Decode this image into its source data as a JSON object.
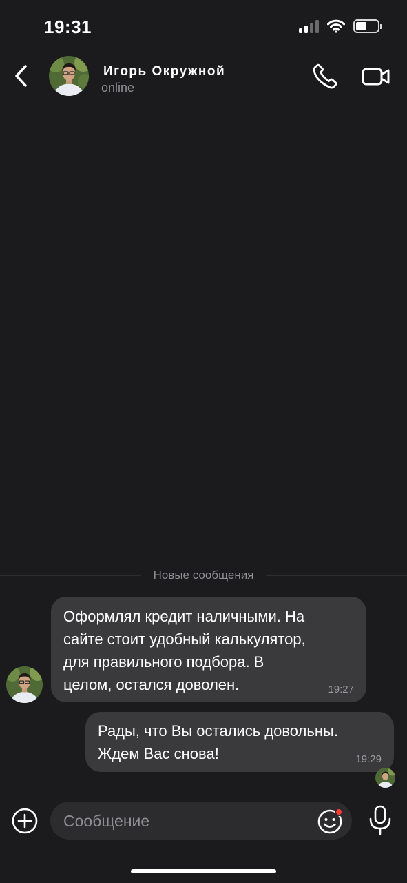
{
  "status_bar": {
    "time": "19:31",
    "signal_icon": "cellular-signal-icon",
    "wifi_icon": "wifi-icon",
    "battery_icon": "battery-icon",
    "battery_level": 0.5
  },
  "header": {
    "back_icon": "chevron-left-icon",
    "contact_name": "Игорь Окружной",
    "contact_status": "online",
    "call_icon": "phone-icon",
    "video_icon": "video-camera-icon"
  },
  "chat": {
    "divider_label": "Новые сообщения",
    "messages": [
      {
        "direction": "incoming",
        "lines": [
          "Оформлял кредит наличными. На",
          "сайте стоит удобный калькулятор,",
          "для правильного подбора. В",
          "целом, остался доволен."
        ],
        "time": "19:27"
      },
      {
        "direction": "outgoing",
        "lines": [
          "Рады, что Вы остались довольны.",
          "Ждем Вас снова!"
        ],
        "time": "19:29"
      }
    ]
  },
  "composer": {
    "add_icon": "plus-circle-icon",
    "placeholder": "Сообщение",
    "emoji_icon": "smiley-icon",
    "mic_icon": "microphone-icon"
  },
  "colors": {
    "background": "#1b1b1d",
    "bubble": "#3a3a3c",
    "secondary_text": "#8e8e93",
    "input_background": "#2c2c2e",
    "notification_dot": "#ff3b30"
  }
}
